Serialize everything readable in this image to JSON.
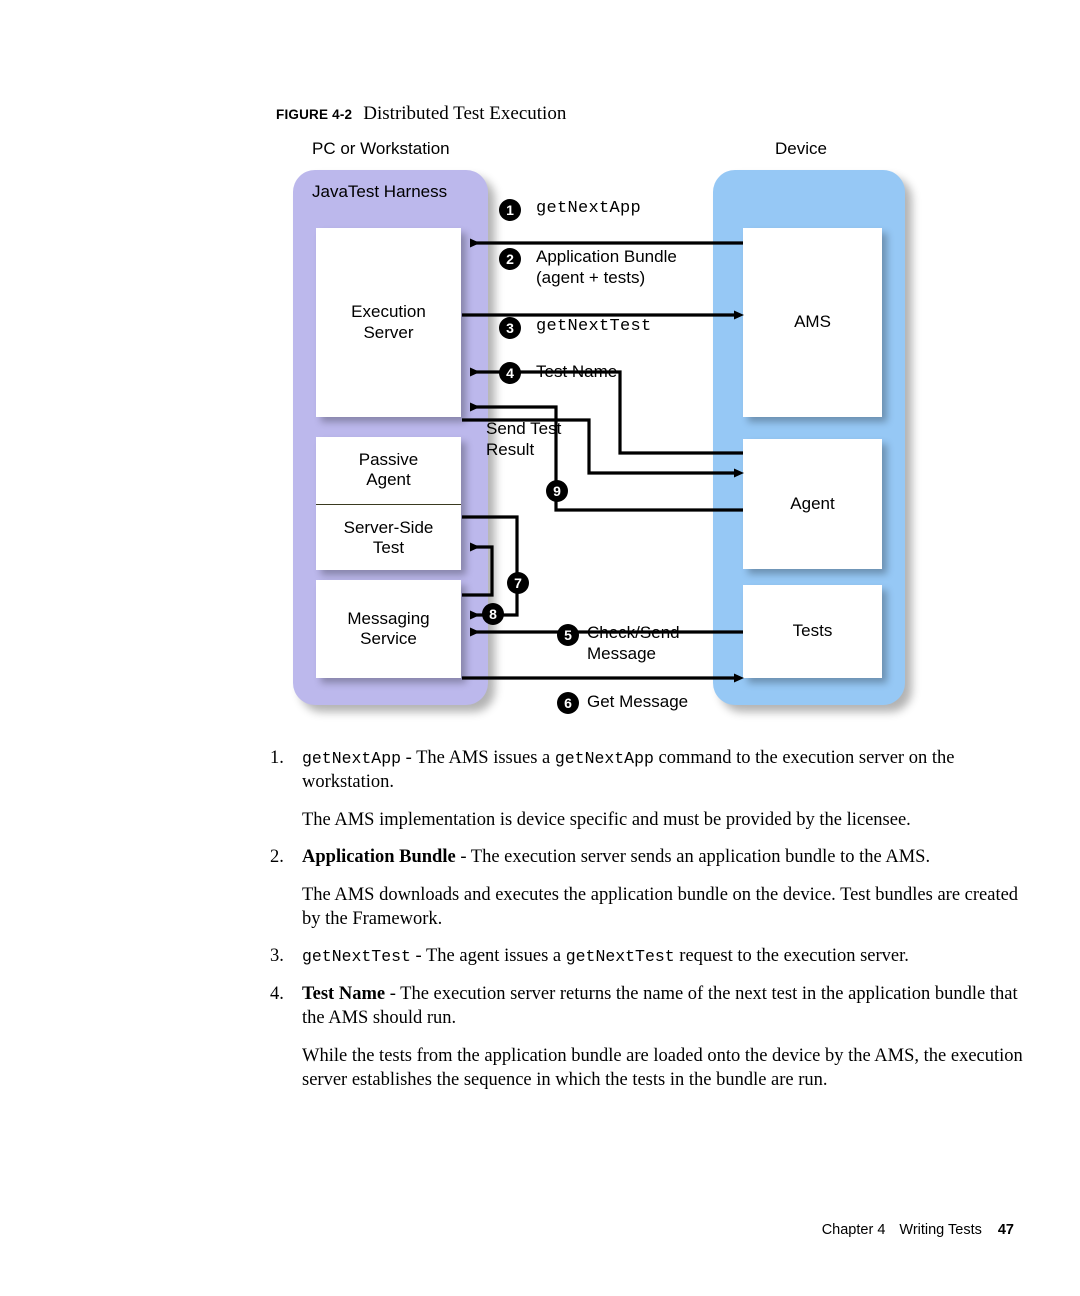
{
  "figure": {
    "label": "FIGURE 4-2",
    "title": "Distributed Test Execution"
  },
  "diagram": {
    "left_caption": "PC or Workstation",
    "right_caption": "Device",
    "left_panel_title": "JavaTest Harness",
    "left_panel_color": "#bcb8ec",
    "right_panel_color": "#96c8f5",
    "boxes": {
      "execution_server": "Execution\nServer",
      "execution_server_line1": "Execution",
      "execution_server_line2": "Server",
      "passive_agent_line1": "Passive",
      "passive_agent_line2": "Agent",
      "server_side_test_line1": "Server-Side",
      "server_side_test_line2": "Test",
      "messaging_service_line1": "Messaging",
      "messaging_service_line2": "Service",
      "ams": "AMS",
      "agent": "Agent",
      "tests": "Tests"
    },
    "flows": [
      {
        "num": "1",
        "label": "getNextApp",
        "mono": true
      },
      {
        "num": "2",
        "label": "Application Bundle",
        "label2": "(agent + tests)",
        "mono": false
      },
      {
        "num": "3",
        "label": "getNextTest",
        "mono": true
      },
      {
        "num": "4",
        "label": "Test Name",
        "mono": false
      },
      {
        "num": "5",
        "label": "Check/Send",
        "label2": "Message",
        "mono": false
      },
      {
        "num": "6",
        "label": "Get Message",
        "mono": false
      },
      {
        "num": "7",
        "label": "",
        "mono": false
      },
      {
        "num": "8",
        "label": "",
        "mono": false
      },
      {
        "num": "9",
        "label": "Send Test",
        "label2": "Result",
        "mono": false
      }
    ]
  },
  "steps": [
    {
      "num": "1.",
      "parts": [
        {
          "t": "getNextApp",
          "s": "mono"
        },
        {
          "t": " - The AMS issues a ",
          "s": ""
        },
        {
          "t": "getNextApp",
          "s": "mono"
        },
        {
          "t": " command to the execution server on the workstation.",
          "s": ""
        }
      ]
    },
    {
      "para": "The AMS implementation is device specific and must be provided by the licensee."
    },
    {
      "num": "2.",
      "parts": [
        {
          "t": "Application Bundle",
          "s": "b"
        },
        {
          "t": " - The execution server sends an application bundle to the AMS.",
          "s": ""
        }
      ]
    },
    {
      "para": "The AMS downloads and executes the application bundle on the device. Test bundles are created by the Framework."
    },
    {
      "num": "3.",
      "parts": [
        {
          "t": "getNextTest",
          "s": "mono"
        },
        {
          "t": " - The agent issues a ",
          "s": ""
        },
        {
          "t": "getNextTest",
          "s": "mono"
        },
        {
          "t": " request to the execution server.",
          "s": ""
        }
      ]
    },
    {
      "num": "4.",
      "parts": [
        {
          "t": " Test Name",
          "s": "b"
        },
        {
          "t": " - The execution server returns the name of the next test in the application bundle that the AMS should run.",
          "s": ""
        }
      ]
    },
    {
      "para": "While the tests from the application bundle are loaded onto the device by the AMS, the execution server establishes the sequence in which the tests in the bundle are run."
    }
  ],
  "footer": {
    "chapter": "Chapter 4",
    "section": "Writing Tests",
    "page": "47"
  }
}
